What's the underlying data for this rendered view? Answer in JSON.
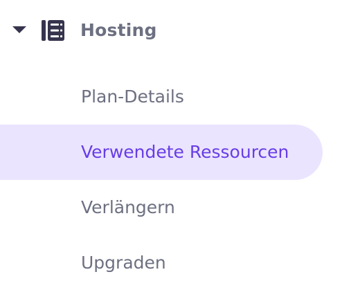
{
  "section": {
    "title": "Hosting",
    "expanded": true,
    "caret_icon": "caret-down-icon",
    "icon": "server-icon"
  },
  "items": [
    {
      "label": "Plan-Details",
      "active": false
    },
    {
      "label": "Verwendete Ressourcen",
      "active": true
    },
    {
      "label": "Verlängern",
      "active": false
    },
    {
      "label": "Upgraden",
      "active": false
    }
  ],
  "colors": {
    "text": "#6d7081",
    "icon": "#36344d",
    "active_text": "#673de6",
    "active_bg": "#ebe4ff"
  }
}
